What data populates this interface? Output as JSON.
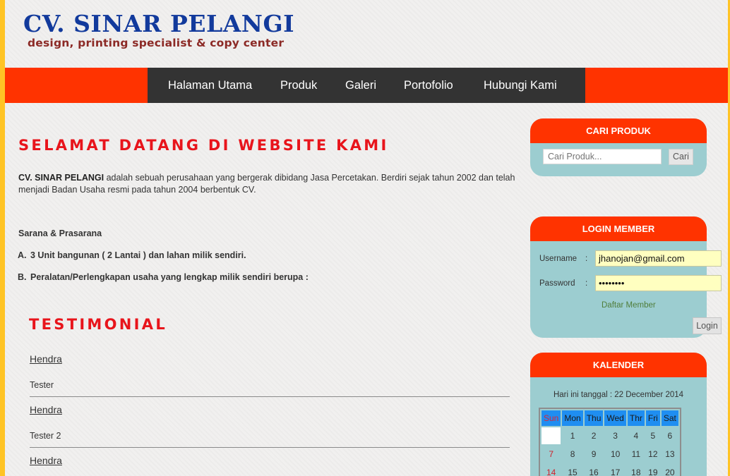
{
  "header": {
    "logo_title": "CV. SINAR PELANGI",
    "logo_subtitle": "design, printing specialist & copy center"
  },
  "nav": {
    "items": [
      {
        "label": "Halaman Utama"
      },
      {
        "label": "Produk"
      },
      {
        "label": "Galeri"
      },
      {
        "label": "Portofolio"
      },
      {
        "label": "Hubungi Kami"
      }
    ]
  },
  "main": {
    "welcome_title": "SELAMAT DATANG DI WEBSITE KAMI",
    "intro_company": "CV. SINAR PELANGI",
    "intro_text": " adalah sebuah perusahaan yang bergerak dibidang Jasa Percetakan. Berdiri sejak tahun 2002 dan telah menjadi Badan Usaha resmi pada tahun 2004 berbentuk CV.",
    "sarana_heading": "Sarana & Prasarana",
    "sarana_items": [
      {
        "marker": "A.",
        "text": "3 Unit bangunan ( 2 Lantai ) dan lahan milik sendiri."
      },
      {
        "marker": "B.",
        "text": "Peralatan/Perlengkapan usaha yang lengkap milik sendiri berupa :"
      }
    ],
    "testimonial_title": "TESTIMONIAL",
    "testimonials": [
      {
        "name": "Hendra",
        "text": "Tester"
      },
      {
        "name": "Hendra",
        "text": "Tester 2"
      },
      {
        "name": "Hendra",
        "text": ""
      }
    ]
  },
  "sidebar": {
    "search": {
      "title": "CARI PRODUK",
      "placeholder": "Cari Produk...",
      "button": "Cari"
    },
    "login": {
      "title": "LOGIN MEMBER",
      "username_label": "Username",
      "password_label": "Password",
      "colon": ":",
      "username_value": "jhanojan@gmail.com",
      "password_value": "••••••••",
      "register_link": "Daftar Member",
      "button": "Login"
    },
    "calendar": {
      "title": "KALENDER",
      "today_text": "Hari ini tanggal : 22 December 2014",
      "weekdays": [
        "Sun",
        "Mon",
        "Thu",
        "Wed",
        "Thr",
        "Fri",
        "Sat"
      ],
      "weeks": [
        [
          "",
          "1",
          "2",
          "3",
          "4",
          "5",
          "6"
        ],
        [
          "7",
          "8",
          "9",
          "10",
          "11",
          "12",
          "13"
        ],
        [
          "14",
          "15",
          "16",
          "17",
          "18",
          "19",
          "20"
        ]
      ]
    }
  }
}
